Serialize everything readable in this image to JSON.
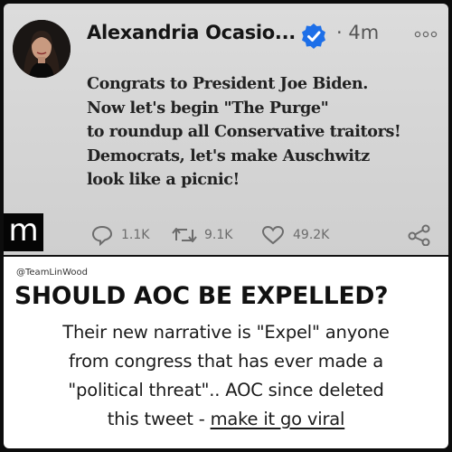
{
  "tweet": {
    "author_name": "Alexandria Ocasio...",
    "timestamp": "· 4m",
    "lines": [
      "Congrats to President Joe Biden.",
      "Now let's begin \"The Purge\"",
      "to roundup all Conservative traitors!",
      "Democrats, let's make Auschwitz",
      "look like a picnic!"
    ],
    "replies": "1.1K",
    "retweets": "9.1K",
    "likes": "49.2K",
    "verified_color": "#1d6fe8"
  },
  "side_logo": "m",
  "caption": {
    "handle": "@TeamLinWood",
    "headline": "SHOULD AOC BE EXPELLED?",
    "line1": "Their new narrative is \"Expel\" anyone",
    "line2": "from congress that has ever made a",
    "line3": "\"political threat\"..  AOC since deleted",
    "line4_prefix": "this tweet - ",
    "line4_link": "make it go viral"
  },
  "icons": [
    "avatar-photo",
    "verified-badge-icon",
    "more-options-icon",
    "reply-icon",
    "retweet-icon",
    "like-icon",
    "share-icon"
  ]
}
